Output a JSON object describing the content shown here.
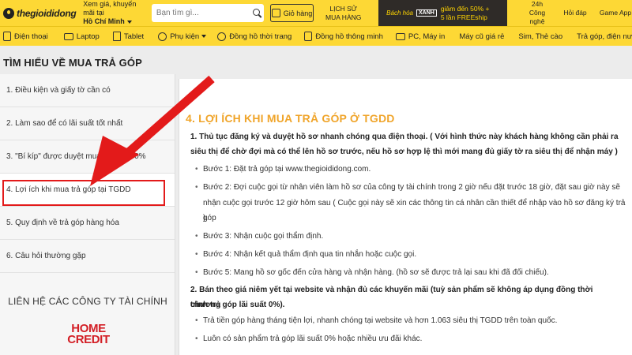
{
  "header": {
    "logo_text": "thegioididong",
    "location_line1": "Xem giá, khuyến mãi tại",
    "location_city": "Hồ Chí Minh",
    "search_placeholder": "Bạn tìm gì...",
    "cart_label": "Giỏ hàng",
    "history_line1": "LỊCH SỬ",
    "history_line2": "MUA HÀNG",
    "promo_brand": "Bách hóa",
    "promo_logo": "XANH",
    "promo_line1": "giảm đến 50% +",
    "promo_line2": "5 lần FREEship",
    "link_24h_line1": "24h",
    "link_24h_line2": "Công nghệ",
    "link_hoidap": "Hỏi đáp",
    "link_game": "Game App"
  },
  "nav": {
    "items": [
      {
        "label": "Điện thoại",
        "icon": "phone-icon"
      },
      {
        "label": "Laptop",
        "icon": "laptop-icon"
      },
      {
        "label": "Tablet",
        "icon": "tablet-icon"
      },
      {
        "label": "Phụ kiện",
        "icon": "headphones-icon"
      },
      {
        "label": "Đồng hồ thời trang",
        "icon": "watch-icon"
      },
      {
        "label": "Đồng hồ thông minh",
        "icon": "smartwatch-icon"
      },
      {
        "label": "PC, Máy in",
        "icon": "monitor-icon"
      },
      {
        "label": "Máy cũ giá rẻ",
        "icon": ""
      },
      {
        "label": "Sim, Thẻ cào",
        "icon": ""
      },
      {
        "label": "Trả góp, điện nước",
        "icon": ""
      }
    ]
  },
  "page_title": "TÌM HIỂU VỀ MUA TRẢ GÓP",
  "sidebar": {
    "items": [
      {
        "label": "1. Điều kiện và giấy tờ cần có"
      },
      {
        "label": "2. Làm sao để có lãi suất tốt nhất"
      },
      {
        "label": "3. \"Bí kíp\" được duyệt mua trả góp 90%"
      },
      {
        "label": "4. Lợi ích khi mua trả góp tại TGDD"
      },
      {
        "label": "5. Quy định về trả góp hàng hóa"
      },
      {
        "label": "6. Câu hỏi thường gặp"
      }
    ],
    "contact_title": "LIÊN HỆ CÁC CÔNG TY TÀI CHÍNH",
    "partner_logo_line1": "HOME",
    "partner_logo_line2": "CREDIT"
  },
  "content": {
    "heading": "4. LỢI ÍCH KHI MUA TRẢ GÓP Ở TGDD",
    "p1_line1": "1. Thủ tục đăng ký và duyệt hồ sơ nhanh chóng qua điện thoại. ( Với hình thức này khách hàng không cần phải ra",
    "p1_line2": "siêu thị để chờ đợi mà có thể lên hồ sơ trước, nếu hồ sơ hợp lệ thì mới mang đủ giấy tờ ra siêu thị để nhận máy )",
    "steps": [
      "Bước 1: Đặt trả góp tại www.thegioididong.com.",
      "Bước 2: Đợi cuộc gọi từ nhân viên làm hồ sơ của công ty tài chính trong 2 giờ nếu đặt trước 18 giờ, đặt sau giờ này sẽ",
      "nhận cuộc gọi trước 12 giờ hôm sau ( Cuộc gọi này sẽ xin các thông tin cá nhân cần thiết để nhập vào hồ sơ đăng ký trả góp",
      ").",
      "Bước 3: Nhận cuộc gọi thẩm định.",
      "Bước 4: Nhận kết quả thẩm định qua tin nhắn hoặc cuộc gọi.",
      "Bước 5: Mang hồ sơ gốc đến cửa hàng và nhận hàng. (hồ sơ sẽ được trả lại sau khi đã đối chiếu)."
    ],
    "p2_line1": "2. Bán theo giá niêm yết tại website và nhận đủ các khuyến mãi (tuỳ sản phẩm sẽ không áp dụng đồng thời chương",
    "p2_line2": "trình trả góp lãi suất 0%).",
    "benefits": [
      "Trả tiền góp hàng tháng tiện lợi, nhanh chóng tại website và hơn 1.063 siêu thị TGDD trên toàn quốc.",
      "Luôn có sản phẩm trả góp lãi suất 0% hoặc nhiều ưu đãi khác."
    ]
  },
  "colors": {
    "header_bg": "#fdd835",
    "heading": "#f0a52b",
    "annotation": "#e31a1a",
    "partner_logo": "#d31f26"
  }
}
